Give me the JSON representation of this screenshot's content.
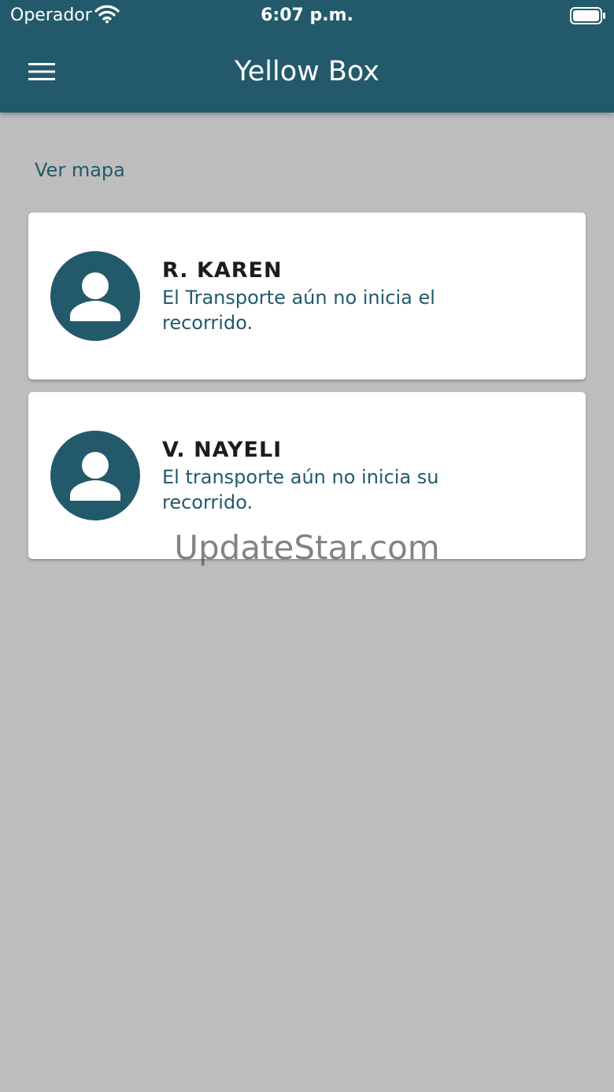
{
  "status_bar": {
    "carrier": "Operador",
    "time": "6:07 p.m.",
    "wifi_icon": "wifi-icon",
    "battery_icon": "battery-icon"
  },
  "app_bar": {
    "menu_icon": "hamburger-menu-icon",
    "title": "Yellow Box"
  },
  "main": {
    "map_link": "Ver mapa",
    "students": [
      {
        "avatar_icon": "person-icon",
        "name": "R. KAREN",
        "status": "El Transporte aún no inicia el recorrido."
      },
      {
        "avatar_icon": "person-icon",
        "name": "V. NAYELI",
        "status": "El transporte aún no inicia su recorrido."
      }
    ]
  },
  "watermark": "UpdateStar.com",
  "colors": {
    "primary": "#235a6b",
    "background": "#bdbdbd",
    "card": "#ffffff",
    "name_text": "#1c1c1c"
  }
}
